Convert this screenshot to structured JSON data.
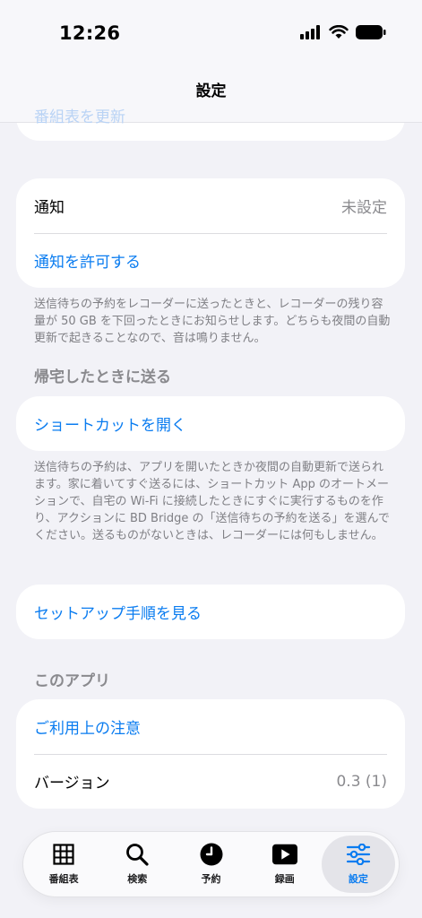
{
  "status_bar": {
    "time": "12:26"
  },
  "header": {
    "title": "設定",
    "behind_link": "番組表を更新"
  },
  "notifications": {
    "row_label": "通知",
    "row_value": "未設定",
    "allow_link": "通知を許可する",
    "note": "送信待ちの予約をレコーダーに送ったときと、レコーダーの残り容量が 50 GB を下回ったときにお知らせします。どちらも夜間の自動更新で起きることなので、音は鳴りません。"
  },
  "send_at_home": {
    "section_title": "帰宅したときに送る",
    "open_shortcut_link": "ショートカットを開く",
    "note": "送信待ちの予約は、アプリを開いたときか夜間の自動更新で送られます。家に着いてすぐ送るには、ショートカット App のオートメーションで、自宅の Wi-Fi に接続したときにすぐに実行するものを作り、アクションに BD Bridge の「送信待ちの予約を送る」を選んでください。送るものがないときは、レコーダーには何もしません。"
  },
  "setup": {
    "guide_link": "セットアップ手順を見る"
  },
  "about": {
    "section_title": "このアプリ",
    "terms_link": "ご利用上の注意",
    "version_label": "バージョン",
    "version_value": "0.3 (1)"
  },
  "tabbar": {
    "tabs": [
      {
        "label": "番組表",
        "icon": "grid-icon"
      },
      {
        "label": "検索",
        "icon": "magnifier-icon"
      },
      {
        "label": "予約",
        "icon": "clock-icon"
      },
      {
        "label": "録画",
        "icon": "play-icon"
      },
      {
        "label": "設定",
        "icon": "sliders-icon",
        "active": true
      }
    ],
    "accent_color": "#0a7cf0"
  },
  "colors": {
    "link": "#0a7cf0",
    "background": "#f2f2f7",
    "secondary_text": "#8a8a8e"
  }
}
